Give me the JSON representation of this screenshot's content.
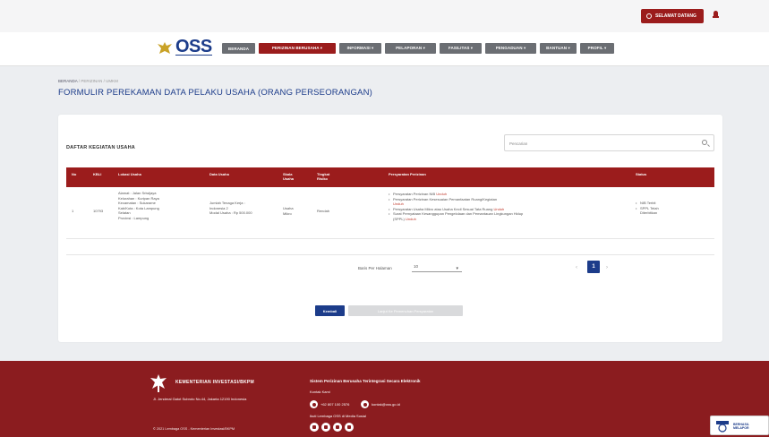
{
  "topbar": {
    "user_label": "SELAMAT DATANG"
  },
  "logo": {
    "text": "OSS"
  },
  "nav": [
    {
      "label": "BERANDA"
    },
    {
      "label": "PERIZINAN BERUSAHA ▾"
    },
    {
      "label": "INFORMASI ▾"
    },
    {
      "label": "PELAPORAN ▾"
    },
    {
      "label": "FASILITAS ▾"
    },
    {
      "label": "PENGADUAN ▾"
    },
    {
      "label": "BANTUAN ▾"
    },
    {
      "label": "PROFIL ▾"
    }
  ],
  "breadcrumb": {
    "home": "BERANDA",
    "sep1": "/",
    "mid": "PERIZINAN",
    "sep2": "/",
    "current": "UMKM"
  },
  "page": {
    "title": "FORMULIR PEREKAMAN DATA PELAKU USAHA (ORANG PERSEORANGAN)"
  },
  "section": {
    "title": "DAFTAR KEGIATAN USAHA"
  },
  "search": {
    "placeholder": "Pencarian"
  },
  "table": {
    "headers": [
      "No",
      "KBLI",
      "Lokasi Usaha",
      "Data Usaha",
      "Skala Usaha",
      "Tingkat Risiko",
      "Persyaratan Perizinan",
      "Status"
    ],
    "row": {
      "no": "1",
      "kbli": "10793",
      "lokasi": [
        "Alamat : Jalan Sriwijaya",
        "Kelurahan : Kuripan Raya",
        "Kecamatan : Sukarame",
        "Kab/Kota : Kota Lampung",
        "Selatan",
        "Provinsi : Lampung"
      ],
      "data_usaha": [
        "Jumlah Tenaga Kerja :",
        "Indonesia 2",
        "Modal Usaha : Rp 500.000"
      ],
      "skala": [
        "Usaha",
        "Mikro"
      ],
      "risiko": "Rendah",
      "syarat": [
        {
          "text": "Persyaratan Perizinan NIB",
          "link": "Unduh"
        },
        {
          "text": "Persyaratan Perizinan Kesesuaian Pemanfaatan Ruang/Kegiatan",
          "link": ""
        },
        {
          "text": "Unduh",
          "link": ""
        },
        {
          "text": "Persyaratan Usaha Mikro atau Usaha Kecil Sesuai Tata Ruang",
          "link": "Unduh"
        },
        {
          "text": "Surat Pernyataan Kesanggupan Pengelolaan dan Pemantauan Lingkungan Hidup",
          "link": ""
        },
        {
          "text": "(SPPL)",
          "link": "Unduh"
        }
      ],
      "status": [
        "NIB Terbit",
        "SPPL Telah",
        "Diterbitkan"
      ]
    }
  },
  "pagination": {
    "rows_label": "Baris Per Halaman",
    "rows_value": "10",
    "prev": "‹",
    "page": "1",
    "next": "›"
  },
  "buttons": {
    "back": "Kembali",
    "next": "Lanjut Ke Pemenuhan Persyaratan"
  },
  "footer": {
    "org": "KEMENTERIAN INVESTASI/BKPM",
    "address": "Jl. Jenderal Gatot Subroto No.44, Jakarta 12190 Indonesia",
    "copyright": "© 2021 Lembaga OSS - Kementerian Investasi/BKPM",
    "heading": "Sistem Perizinan Berusaha Terintegrasi Secara Elektronik",
    "contact_label": "Kontak Kami",
    "phone": "+62 807 100 2576",
    "email": "kontak@oss.go.id",
    "social_label": "Ikuti Lembaga OSS di Media Sosial"
  },
  "badge": {
    "line1": "BERHASIL",
    "line2": "MELAPOR"
  },
  "colors": {
    "brand_red": "#9b1c1c",
    "brand_blue": "#1c3c8a",
    "footer_red": "#8b1c1f"
  }
}
